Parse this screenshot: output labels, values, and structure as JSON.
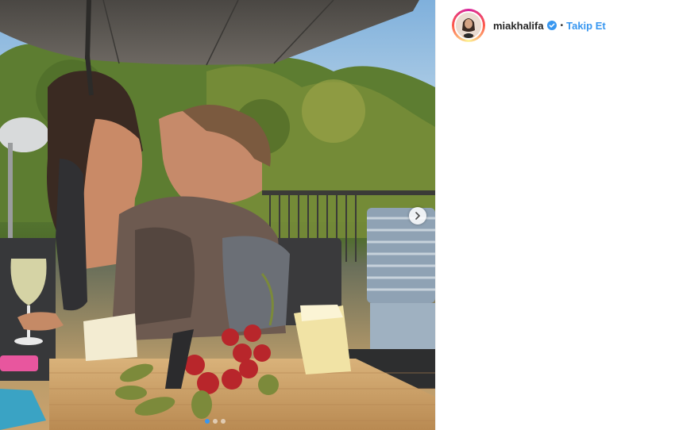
{
  "post": {
    "username": "miakhalifa",
    "verified": true,
    "separator": "•",
    "follow_label": "Takip Et",
    "carousel": {
      "slide_count": 3,
      "active_index": 0
    }
  },
  "colors": {
    "link_blue": "#3897f0",
    "text_dark": "#262626",
    "verified_blue": "#3897f0"
  },
  "icons": {
    "verified": "verified-badge-icon",
    "next": "chevron-right-icon"
  }
}
